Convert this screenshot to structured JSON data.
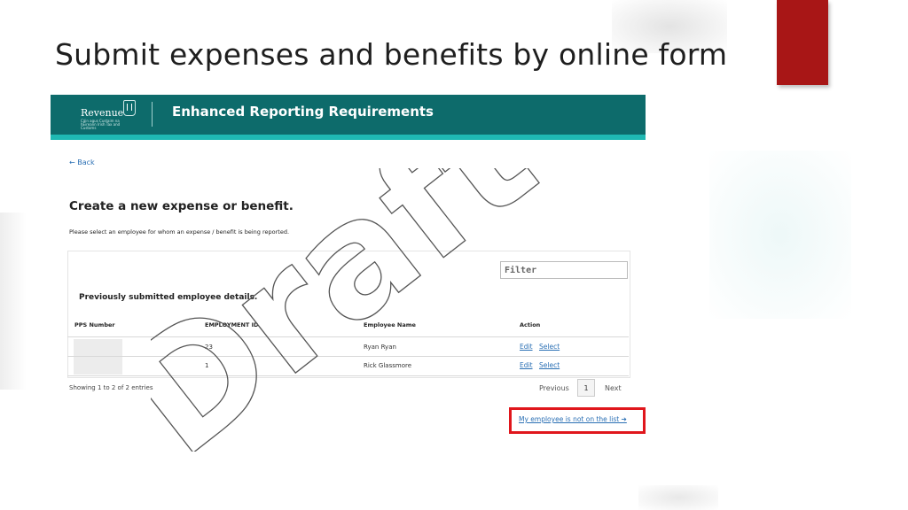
{
  "slide": {
    "title": "Submit expenses and benefits by online form",
    "accent_color": "#a81616"
  },
  "portal": {
    "brand": "Revenue",
    "brand_sub": "Cáin agus Custaim na hÉireann Irish Tax and Customs",
    "brand_icon": "harp-icon",
    "header_title": "Enhanced Reporting Requirements",
    "header_color": "#0d6b6b",
    "stripe_color": "#1fb9b3",
    "back_label": "← Back",
    "heading": "Create a new expense or benefit.",
    "description": "Please select an employee for whom an expense / benefit is being reported.",
    "filter_placeholder": "Filter",
    "subheading": "Previously submitted employee details.",
    "table": {
      "columns": [
        "PPS Number",
        "EMPLOYMENT ID",
        "Employee Name",
        "Action"
      ],
      "rows": [
        {
          "pps": "",
          "employment_id": "23",
          "name": "Ryan Ryan",
          "edit": "Edit",
          "select": "Select"
        },
        {
          "pps": "",
          "employment_id": "1",
          "name": "Rick Glassmore",
          "edit": "Edit",
          "select": "Select"
        }
      ]
    },
    "showing": "Showing 1 to 2 of 2 entries",
    "pagination": {
      "previous": "Previous",
      "current": "1",
      "next": "Next"
    },
    "not_on_list_link": "My employee is not on the list ➔",
    "highlight_color": "#e0161c"
  },
  "watermark": {
    "text": "Draft"
  }
}
